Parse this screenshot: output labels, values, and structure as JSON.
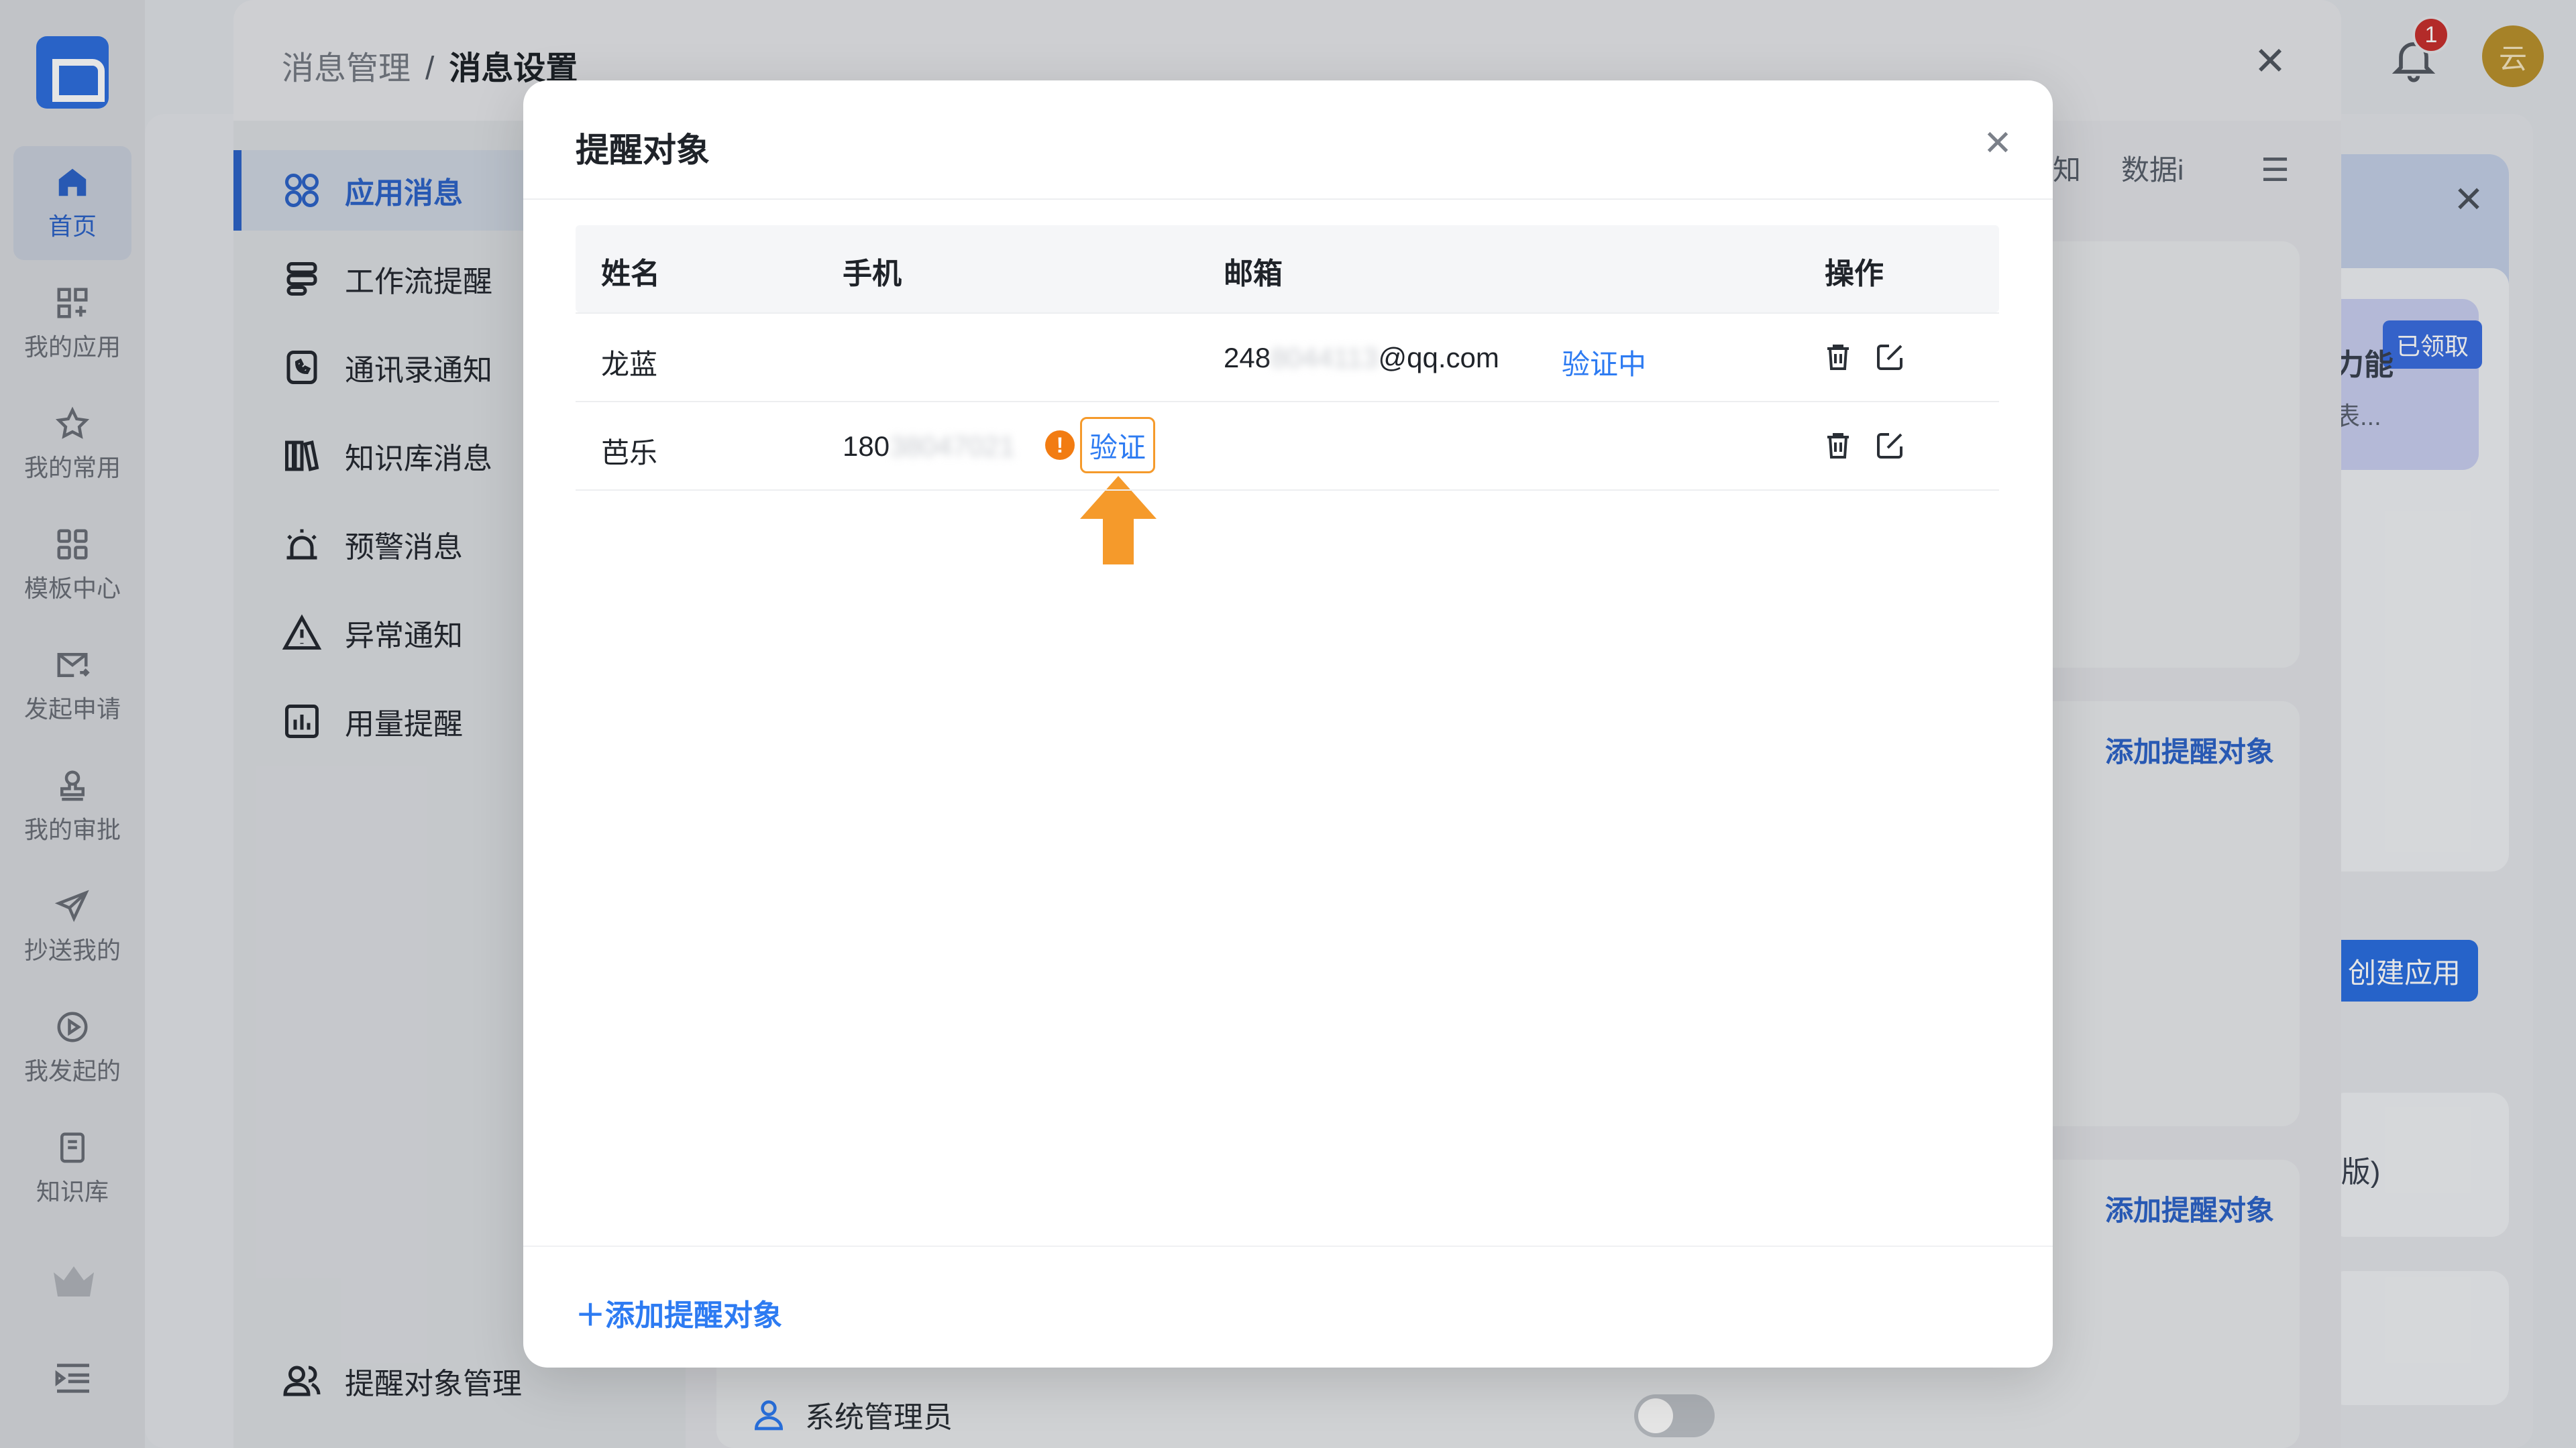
{
  "nav": {
    "items": [
      {
        "label": "首页",
        "icon": "home-icon"
      },
      {
        "label": "我的应用",
        "icon": "apps-plus-icon"
      },
      {
        "label": "我的常用",
        "icon": "star-icon"
      },
      {
        "label": "模板中心",
        "icon": "grid-icon"
      },
      {
        "label": "发起申请",
        "icon": "mail-send-icon"
      },
      {
        "label": "我的审批",
        "icon": "stamp-icon"
      },
      {
        "label": "抄送我的",
        "icon": "paper-plane-icon"
      },
      {
        "label": "我发起的",
        "icon": "play-circle-icon"
      },
      {
        "label": "知识库",
        "icon": "book-icon"
      }
    ]
  },
  "header": {
    "notification_count": "1",
    "avatar_text": "云"
  },
  "drawer": {
    "breadcrumb_parent": "消息管理",
    "breadcrumb_sep": "/",
    "breadcrumb_current": "消息设置",
    "menu": [
      {
        "label": "应用消息",
        "icon": "apps-icon",
        "active": true
      },
      {
        "label": "工作流提醒",
        "icon": "workflow-icon",
        "active": false
      },
      {
        "label": "通讯录通知",
        "icon": "contact-phone-icon",
        "active": false
      },
      {
        "label": "知识库消息",
        "icon": "library-icon",
        "active": false
      },
      {
        "label": "预警消息",
        "icon": "alarm-icon",
        "active": false
      },
      {
        "label": "异常通知",
        "icon": "warning-icon",
        "active": false
      },
      {
        "label": "用量提醒",
        "icon": "usage-chart-icon",
        "active": false
      }
    ],
    "menu_bottom": "提醒对象管理",
    "tabs_right": [
      "知",
      "数据i"
    ],
    "add_target_1": "添加提醒对象",
    "add_target_2": "添加提醒对象",
    "system_admin": "系统管理员"
  },
  "background": {
    "badge_claimed": "已领取",
    "feature_text": "力能",
    "feature_sub": "表...",
    "create_app": "创建应用",
    "version_text": "l版)"
  },
  "modal": {
    "title": "提醒对象",
    "columns": [
      "姓名",
      "手机",
      "邮箱",
      "操作"
    ],
    "rows": [
      {
        "name": "龙蓝",
        "phone_visible": "",
        "phone_masked": "",
        "email_prefix": "248",
        "email_masked": "8044113",
        "email_suffix": "@qq.com",
        "status": "验证中"
      },
      {
        "name": "芭乐",
        "phone_visible": "180",
        "phone_masked": "38047021",
        "email_prefix": "",
        "email_masked": "",
        "email_suffix": "",
        "status": "验证"
      }
    ],
    "warning_mark": "!",
    "footer_add": "＋添加提醒对象"
  },
  "colors": {
    "primary": "#2d7bf2",
    "highlight": "#f59a2b",
    "warning": "#f27c12"
  }
}
